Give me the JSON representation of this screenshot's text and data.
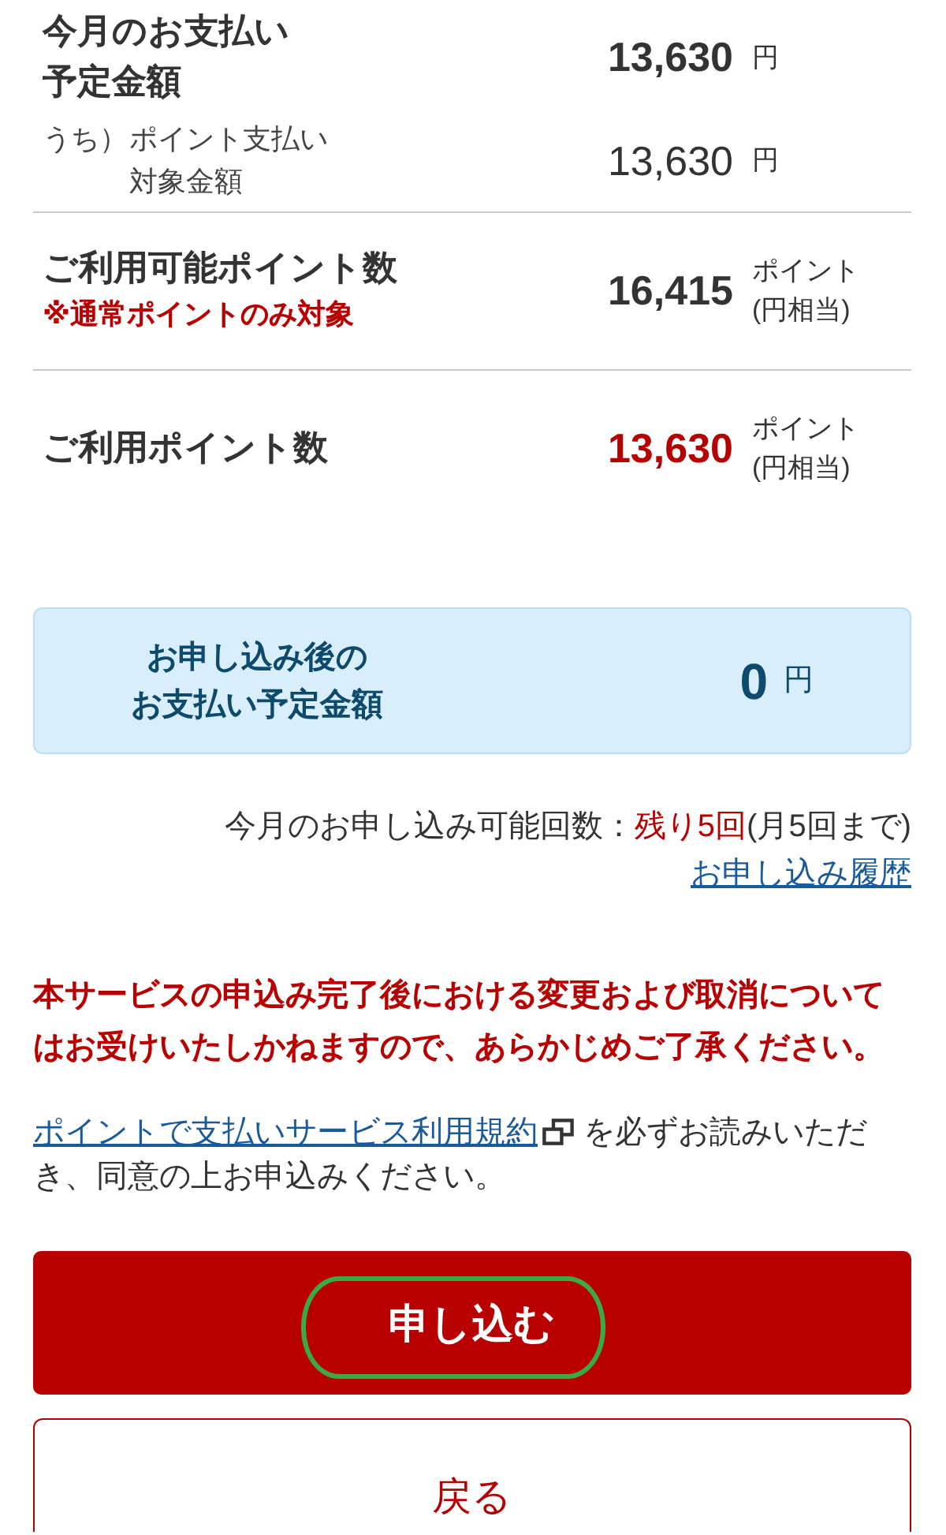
{
  "payment_summary": [
    {
      "kind": "total",
      "label": [
        "今月のお支払い",
        "予定金額"
      ],
      "amount": "13,630",
      "unit": [
        "円"
      ]
    },
    {
      "kind": "breakdown",
      "prefix": "うち）",
      "label": [
        "ポイント支払い",
        "対象金額"
      ],
      "amount": "13,630",
      "unit": [
        "円"
      ]
    },
    {
      "kind": "points",
      "label": [
        "ご利用可能ポイント数"
      ],
      "note": "※通常ポイントのみ対象",
      "amount": "16,415",
      "unit": [
        "ポイント",
        "(円相当)"
      ],
      "emphasized": false
    },
    {
      "kind": "points",
      "label": [
        "ご利用ポイント数"
      ],
      "amount": "13,630",
      "unit": [
        "ポイント",
        "(円相当)"
      ],
      "emphasized": true
    }
  ],
  "after_application": {
    "label": [
      "お申し込み後の",
      "お支払い予定金額"
    ],
    "amount": "0",
    "unit": "円"
  },
  "application_count": {
    "label": "今月のお申し込み可能回数：",
    "remaining": "残り5回",
    "limit": "(月5回まで)",
    "history_link": "お申し込み履歴"
  },
  "warning": "本サービスの申込み完了後における変更および取消についてはお受けいたしかねますので、あらかじめご了承ください。",
  "terms": {
    "link": "ポイントで支払いサービス利用規約",
    "text": "を必ずお読みいただき、同意の上お申込みください。"
  },
  "buttons": [
    {
      "kind": "primary",
      "label": "申し込む",
      "highlighted": true
    },
    {
      "kind": "secondary",
      "label": "戻る",
      "highlighted": false
    }
  ]
}
